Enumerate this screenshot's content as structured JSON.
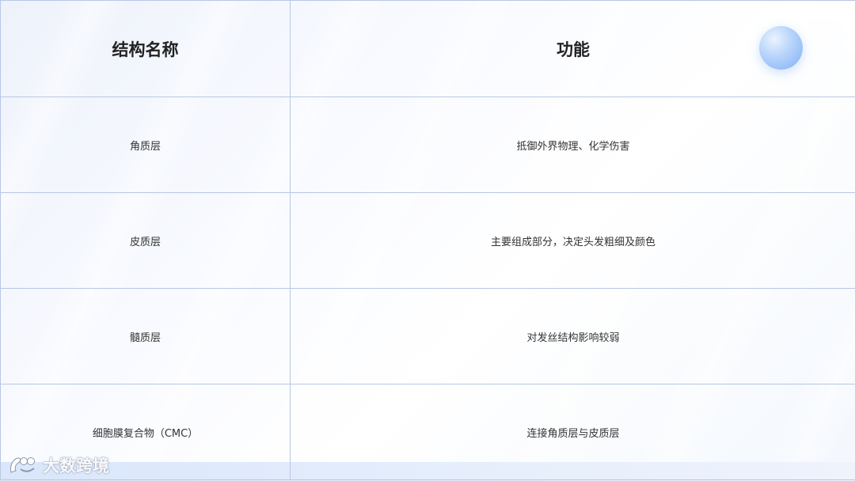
{
  "table": {
    "headers": [
      "结构名称",
      "功能"
    ],
    "rows": [
      {
        "name": "角质层",
        "function": "抵御外界物理、化学伤害"
      },
      {
        "name": "皮质层",
        "function": "主要组成部分，决定头发粗细及颜色"
      },
      {
        "name": "髓质层",
        "function": "对发丝结构影响较弱"
      },
      {
        "name": "细胞膜复合物（CMC）",
        "function": "连接角质层与皮质层"
      }
    ]
  },
  "watermark": {
    "text": "大数跨境",
    "icon": "brand-logo-icon"
  },
  "colors": {
    "border": "#b9c7e4",
    "accent_orb": "#7fb0f3"
  }
}
